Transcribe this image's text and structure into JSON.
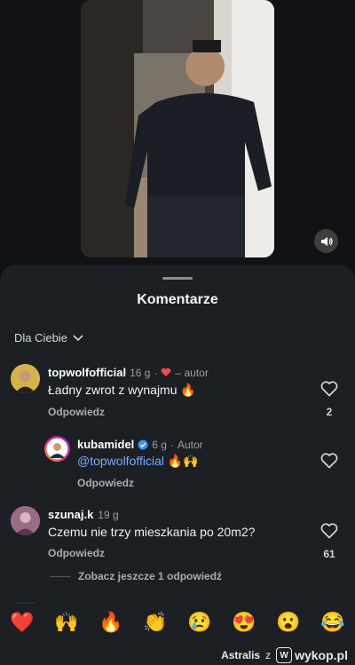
{
  "video": {
    "mute_icon": "speaker-icon"
  },
  "comments_sheet": {
    "title": "Komentarze",
    "sort_label": "Dla Ciebie",
    "comments": [
      {
        "username": "topwolfofficial",
        "time": "16 g",
        "liked_by_author": "– autor",
        "text": "Ładny zwrot z wynajmu 🔥",
        "reply_label": "Odpowiedz",
        "likes": "2"
      },
      {
        "username": "kubamidel",
        "verified": true,
        "time": "6 g",
        "author_badge": "Autor",
        "text_mention": "@topwolfofficial",
        "text": " 🔥🙌",
        "reply_label": "Odpowiedz"
      },
      {
        "username": "szunaj.k",
        "time": "19 g",
        "text": "Czemu nie trzy mieszkania po 20m2?",
        "reply_label": "Odpowiedz",
        "likes": "61"
      }
    ],
    "more_replies": "Zobacz jeszcze 1 odpowiedź"
  },
  "emoji_bar": [
    "❤️",
    "🙌",
    "🔥",
    "👏",
    "😢",
    "😍",
    "😮",
    "😂"
  ],
  "footer": {
    "author": "Astralis",
    "separator": "z",
    "site": "wykop.pl"
  },
  "colors": {
    "background": "#0f1114",
    "sheet": "#1c1f23",
    "mention": "#7fa8ff",
    "heart_red": "#ed4956"
  }
}
